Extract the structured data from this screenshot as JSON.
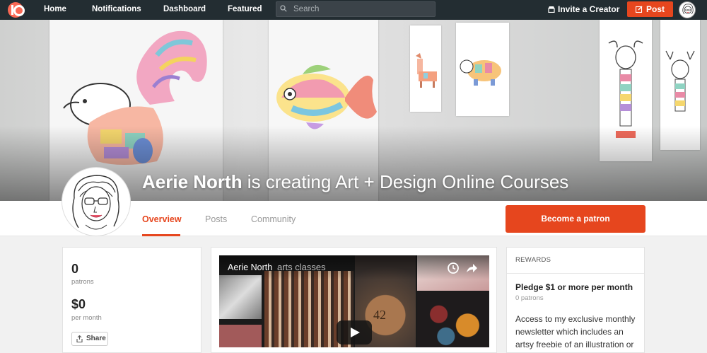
{
  "nav": {
    "home": "Home",
    "notifications": "Notifications",
    "dashboard": "Dashboard",
    "featured": "Featured",
    "search_placeholder": "Search",
    "invite": "Invite a Creator",
    "post": "Post"
  },
  "banner": {
    "creator_name": "Aerie North",
    "tagline": " is creating Art + Design Online Courses"
  },
  "tabs": {
    "overview": "Overview",
    "posts": "Posts",
    "community": "Community",
    "become_patron": "Become a patron"
  },
  "stats": {
    "patrons_count": "0",
    "patrons_label": "patrons",
    "amount": "$0",
    "amount_label": "per month",
    "share": "Share"
  },
  "video": {
    "title": "Aerie North",
    "subtitle": "arts classes"
  },
  "rewards": {
    "heading": "REWARDS",
    "tier_title": "Pledge $1 or more per month",
    "tier_patrons": "0 patrons",
    "tier_description": "Access to my exclusive monthly newsletter which includes an artsy freebie of an illustration or"
  },
  "colors": {
    "accent": "#e6461e",
    "nav_bg": "#232d32",
    "logo": "#f96854"
  },
  "icons": {
    "search": "search-icon",
    "invite": "store-icon",
    "post": "edit-icon",
    "share": "share-icon",
    "watch_later": "clock-icon",
    "share_video": "share-arrow-icon",
    "play": "play-icon"
  }
}
